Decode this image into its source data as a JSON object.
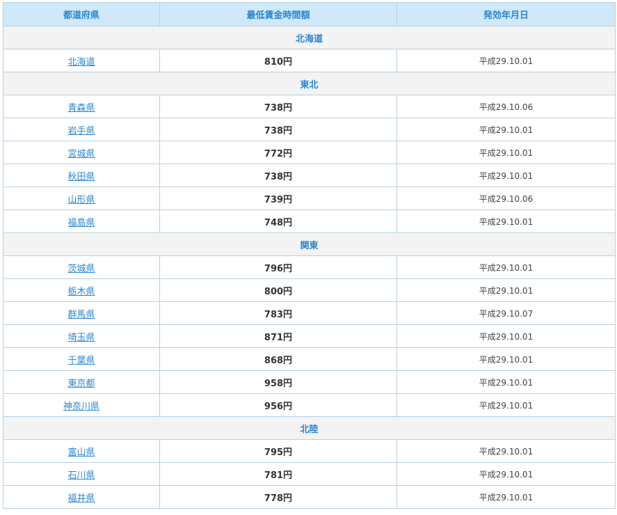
{
  "table": {
    "headers": {
      "prefecture": "都道府県",
      "minimum_wage": "最低賃金時間額",
      "effective_date": "発効年月日"
    },
    "sections": [
      {
        "region": "北海道",
        "rows": [
          {
            "prefecture": "北海道",
            "wage": "810円",
            "date": "平成29.10.01"
          }
        ]
      },
      {
        "region": "東北",
        "rows": [
          {
            "prefecture": "青森県",
            "wage": "738円",
            "date": "平成29.10.06"
          },
          {
            "prefecture": "岩手県",
            "wage": "738円",
            "date": "平成29.10.01"
          },
          {
            "prefecture": "宮城県",
            "wage": "772円",
            "date": "平成29.10.01"
          },
          {
            "prefecture": "秋田県",
            "wage": "738円",
            "date": "平成29.10.01"
          },
          {
            "prefecture": "山形県",
            "wage": "739円",
            "date": "平成29.10.06"
          },
          {
            "prefecture": "福島県",
            "wage": "748円",
            "date": "平成29.10.01"
          }
        ]
      },
      {
        "region": "関東",
        "rows": [
          {
            "prefecture": "茨城県",
            "wage": "796円",
            "date": "平成29.10.01"
          },
          {
            "prefecture": "栃木県",
            "wage": "800円",
            "date": "平成29.10.01"
          },
          {
            "prefecture": "群馬県",
            "wage": "783円",
            "date": "平成29.10.07"
          },
          {
            "prefecture": "埼玉県",
            "wage": "871円",
            "date": "平成29.10.01"
          },
          {
            "prefecture": "千葉県",
            "wage": "868円",
            "date": "平成29.10.01"
          },
          {
            "prefecture": "東京都",
            "wage": "958円",
            "date": "平成29.10.01"
          },
          {
            "prefecture": "神奈川県",
            "wage": "956円",
            "date": "平成29.10.01"
          }
        ]
      },
      {
        "region": "北陸",
        "rows": [
          {
            "prefecture": "富山県",
            "wage": "795円",
            "date": "平成29.10.01"
          },
          {
            "prefecture": "石川県",
            "wage": "781円",
            "date": "平成29.10.01"
          },
          {
            "prefecture": "福井県",
            "wage": "778円",
            "date": "平成29.10.01"
          }
        ]
      }
    ]
  },
  "colors": {
    "header_bg": "#cfe9fb",
    "accent_text": "#2a86d1",
    "region_bg": "#f3f3f3",
    "border": "#b8cfe0"
  }
}
